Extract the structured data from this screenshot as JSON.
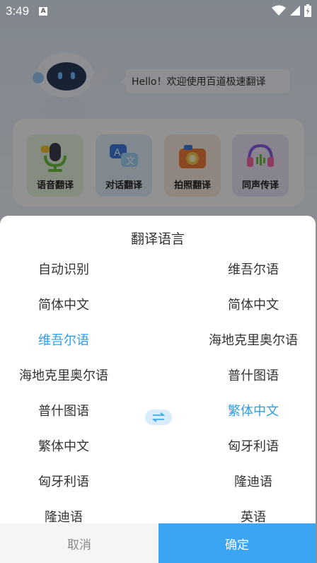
{
  "status_bar": {
    "time": "3:49",
    "notification_badge": "A"
  },
  "header": {
    "greeting": "Hello！欢迎使用百道极速翻译"
  },
  "features": [
    {
      "label": "语音翻译",
      "icon": "microphone-icon"
    },
    {
      "label": "对话翻译",
      "icon": "chat-bubbles-icon"
    },
    {
      "label": "拍照翻译",
      "icon": "camera-icon"
    },
    {
      "label": "同声传译",
      "icon": "headphones-icon"
    }
  ],
  "sheet": {
    "title": "翻译语言",
    "source_languages": [
      "自动识别",
      "简体中文",
      "维吾尔语",
      "海地克里奥尔语",
      "普什图语",
      "繁体中文",
      "匈牙利语",
      "隆迪语"
    ],
    "target_languages": [
      "维吾尔语",
      "简体中文",
      "海地克里奥尔语",
      "普什图语",
      "繁体中文",
      "匈牙利语",
      "隆迪语",
      "英语"
    ],
    "selected_source": "维吾尔语",
    "selected_target": "繁体中文",
    "cancel_label": "取消",
    "confirm_label": "确定"
  },
  "colors": {
    "accent": "#3aa6f3",
    "selected_text": "#2f9ee8"
  }
}
